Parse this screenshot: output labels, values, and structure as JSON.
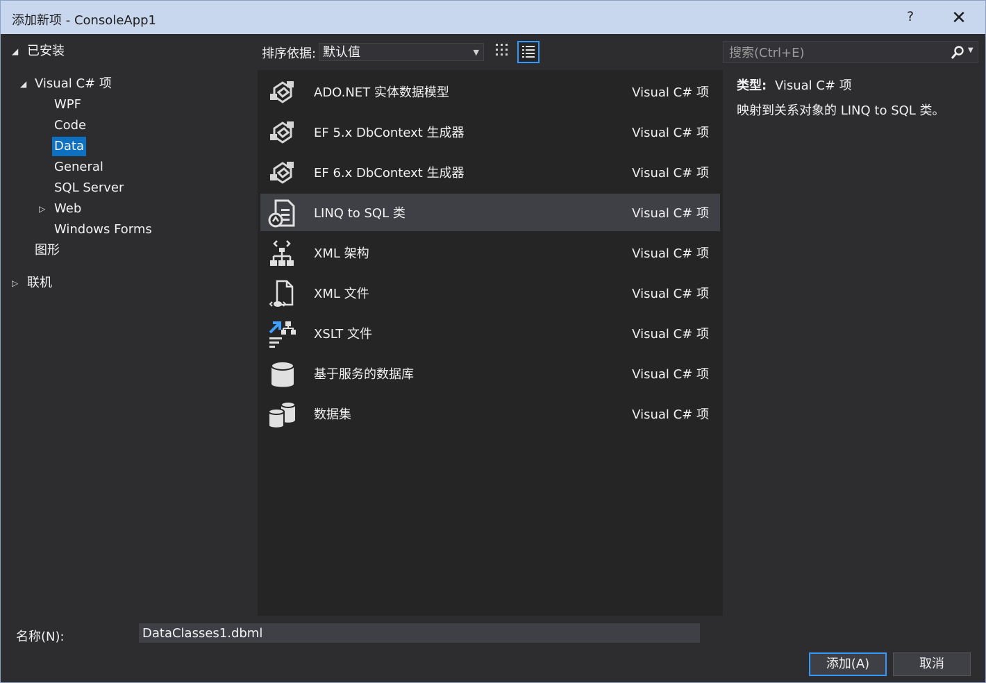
{
  "window": {
    "title": "添加新项 - ConsoleApp1",
    "help": "?",
    "close": "✕"
  },
  "tree": {
    "installed": "已安装",
    "csharp": "Visual C# 项",
    "children": [
      "WPF",
      "Code",
      "Data",
      "General",
      "SQL Server",
      "Web",
      "Windows Forms"
    ],
    "graphics": "图形",
    "online": "联机"
  },
  "toolbar": {
    "sort_label": "排序依据:",
    "sort_value": "默认值"
  },
  "search": {
    "placeholder": "搜索(Ctrl+E)"
  },
  "items": [
    {
      "name": "ADO.NET 实体数据模型",
      "type": "Visual C# 项",
      "icon": "entity-model-icon"
    },
    {
      "name": "EF 5.x DbContext 生成器",
      "type": "Visual C# 项",
      "icon": "entity-model-icon"
    },
    {
      "name": "EF 6.x DbContext 生成器",
      "type": "Visual C# 项",
      "icon": "entity-model-icon"
    },
    {
      "name": "LINQ to SQL 类",
      "type": "Visual C# 项",
      "icon": "linq-to-sql-icon"
    },
    {
      "name": "XML 架构",
      "type": "Visual C# 项",
      "icon": "xml-schema-icon"
    },
    {
      "name": "XML 文件",
      "type": "Visual C# 项",
      "icon": "xml-file-icon"
    },
    {
      "name": "XSLT 文件",
      "type": "Visual C# 项",
      "icon": "xslt-file-icon"
    },
    {
      "name": "基于服务的数据库",
      "type": "Visual C# 项",
      "icon": "database-icon"
    },
    {
      "name": "数据集",
      "type": "Visual C# 项",
      "icon": "dataset-icon"
    }
  ],
  "details": {
    "type_label": "类型:",
    "type_value": "Visual C# 项",
    "description": "映射到关系对象的 LINQ to SQL 类。"
  },
  "bottom": {
    "name_label": "名称(N):",
    "name_value": "DataClasses1.dbml",
    "add": "添加(A)",
    "cancel": "取消"
  },
  "colors": {
    "accent": "#3399ff",
    "selection": "#0e70c0",
    "titlebar": "#c9d7ee"
  }
}
